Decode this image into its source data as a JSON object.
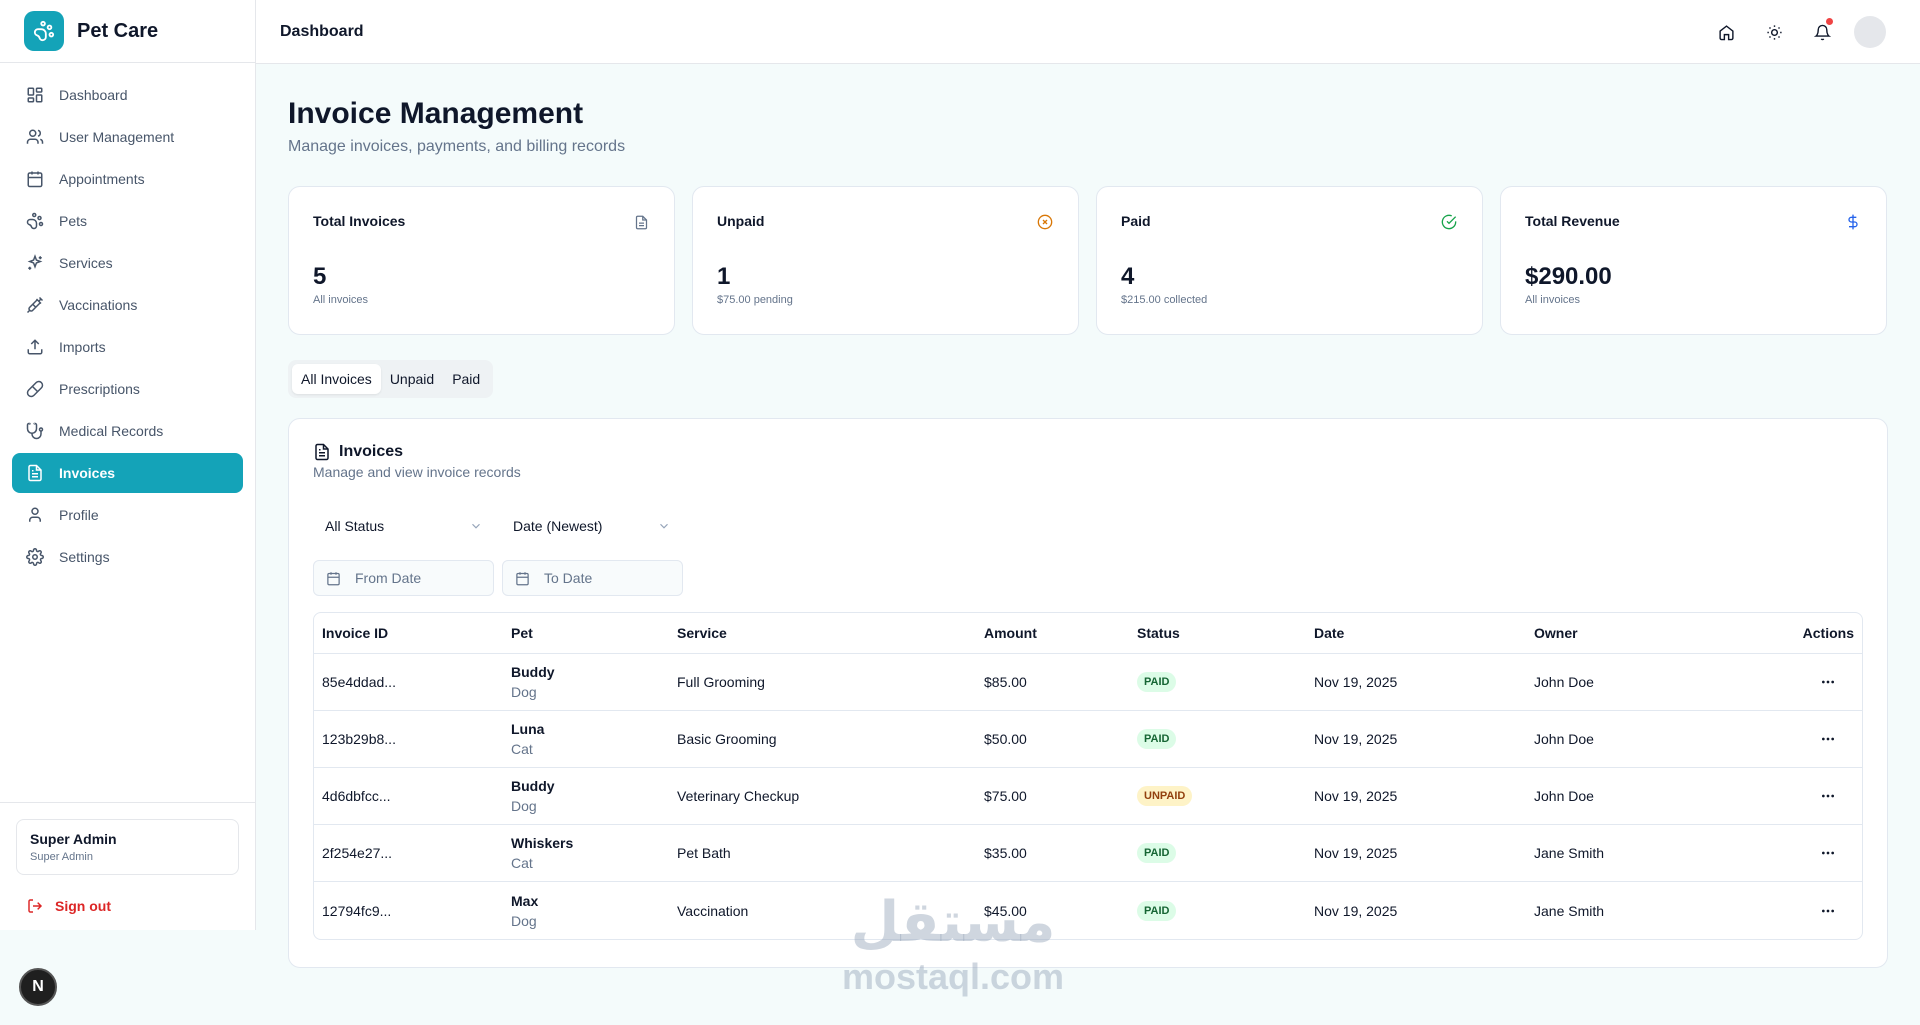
{
  "brand": {
    "name": "Pet Care"
  },
  "header": {
    "title": "Dashboard"
  },
  "sidebar": {
    "items": [
      {
        "label": "Dashboard",
        "icon": "grid-icon"
      },
      {
        "label": "User Management",
        "icon": "users-icon"
      },
      {
        "label": "Appointments",
        "icon": "calendar-icon"
      },
      {
        "label": "Pets",
        "icon": "paw-icon"
      },
      {
        "label": "Services",
        "icon": "sparkles-icon"
      },
      {
        "label": "Vaccinations",
        "icon": "syringe-icon"
      },
      {
        "label": "Imports",
        "icon": "upload-icon"
      },
      {
        "label": "Prescriptions",
        "icon": "pill-icon"
      },
      {
        "label": "Medical Records",
        "icon": "stethoscope-icon"
      },
      {
        "label": "Invoices",
        "icon": "file-icon",
        "active": true
      },
      {
        "label": "Profile",
        "icon": "user-icon"
      },
      {
        "label": "Settings",
        "icon": "gear-icon"
      }
    ],
    "user": {
      "name": "Super Admin",
      "role": "Super Admin"
    },
    "signout_label": "Sign out"
  },
  "page": {
    "title": "Invoice Management",
    "subtitle": "Manage invoices, payments, and billing records"
  },
  "stats": [
    {
      "label": "Total Invoices",
      "value": "5",
      "sub": "All invoices",
      "icon": "file-icon",
      "color": "#64748b"
    },
    {
      "label": "Unpaid",
      "value": "1",
      "sub": "$75.00 pending",
      "icon": "x-circle-icon",
      "color": "#d97706"
    },
    {
      "label": "Paid",
      "value": "4",
      "sub": "$215.00 collected",
      "icon": "check-circle-icon",
      "color": "#16a34a"
    },
    {
      "label": "Total Revenue",
      "value": "$290.00",
      "sub": "All invoices",
      "icon": "dollar-icon",
      "color": "#2563eb"
    }
  ],
  "tabs": [
    {
      "label": "All Invoices",
      "active": true
    },
    {
      "label": "Unpaid"
    },
    {
      "label": "Paid"
    }
  ],
  "panel": {
    "title": "Invoices",
    "description": "Manage and view invoice records",
    "status_filter": "All Status",
    "sort_filter": "Date (Newest)",
    "from_placeholder": "From Date",
    "to_placeholder": "To Date"
  },
  "table": {
    "headers": [
      "Invoice ID",
      "Pet",
      "Service",
      "Amount",
      "Status",
      "Date",
      "Owner",
      "Actions"
    ],
    "rows": [
      {
        "id": "85e4ddad...",
        "pet": "Buddy",
        "type": "Dog",
        "service": "Full Grooming",
        "amount": "$85.00",
        "status": "PAID",
        "date": "Nov 19, 2025",
        "owner": "John Doe"
      },
      {
        "id": "123b29b8...",
        "pet": "Luna",
        "type": "Cat",
        "service": "Basic Grooming",
        "amount": "$50.00",
        "status": "PAID",
        "date": "Nov 19, 2025",
        "owner": "John Doe"
      },
      {
        "id": "4d6dbfcc...",
        "pet": "Buddy",
        "type": "Dog",
        "service": "Veterinary Checkup",
        "amount": "$75.00",
        "status": "UNPAID",
        "date": "Nov 19, 2025",
        "owner": "John Doe"
      },
      {
        "id": "2f254e27...",
        "pet": "Whiskers",
        "type": "Cat",
        "service": "Pet Bath",
        "amount": "$35.00",
        "status": "PAID",
        "date": "Nov 19, 2025",
        "owner": "Jane Smith"
      },
      {
        "id": "12794fc9...",
        "pet": "Max",
        "type": "Dog",
        "service": "Vaccination",
        "amount": "$45.00",
        "status": "PAID",
        "date": "Nov 19, 2025",
        "owner": "Jane Smith"
      }
    ]
  },
  "watermark": {
    "arabic": "مستقل",
    "latin": "mostaql.com"
  },
  "dev_badge": {
    "letter": "N"
  },
  "colors": {
    "accent": "#14a3b8",
    "danger": "#dc2626"
  }
}
